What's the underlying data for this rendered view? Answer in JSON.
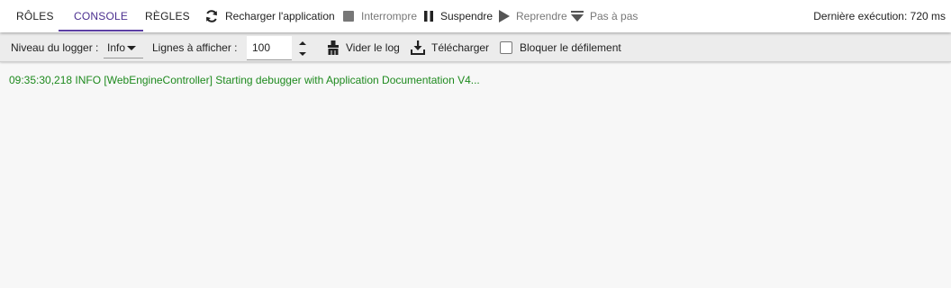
{
  "tabs": [
    {
      "label": "RÔLES",
      "active": false
    },
    {
      "label": "CONSOLE",
      "active": true
    },
    {
      "label": "RÈGLES",
      "active": false
    }
  ],
  "actions": {
    "reload": {
      "label": "Recharger l'application",
      "icon": "refresh-icon",
      "enabled": true
    },
    "interrupt": {
      "label": "Interrompre",
      "icon": "stop-icon",
      "enabled": false
    },
    "suspend": {
      "label": "Suspendre",
      "icon": "pause-icon",
      "enabled": true
    },
    "resume": {
      "label": "Reprendre",
      "icon": "play-icon",
      "enabled": false
    },
    "step": {
      "label": "Pas à pas",
      "icon": "step-icon",
      "enabled": false
    }
  },
  "last_run": "Dernière exécution: 720 ms",
  "toolbar": {
    "logger_level_label": "Niveau du logger :",
    "logger_level_value": "Info",
    "lines_label": "Lignes à afficher :",
    "lines_value": "100",
    "clear_label": "Vider le log",
    "download_label": "Télécharger",
    "lock_scroll_label": "Bloquer le défilement",
    "lock_scroll_checked": false
  },
  "log": {
    "lines": [
      "09:35:30,218 INFO [WebEngineController] Starting debugger with Application Documentation V4..."
    ]
  },
  "colors": {
    "accent": "#5b3fa3",
    "log_text": "#1e8a1e",
    "disabled": "#777777"
  }
}
